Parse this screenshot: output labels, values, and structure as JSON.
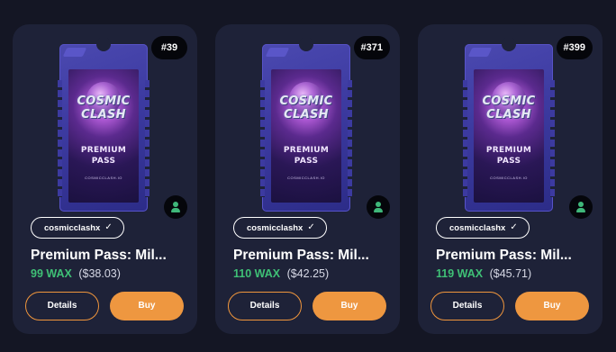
{
  "theme": {
    "page_bg": "#141624",
    "card_bg": "#1e2238",
    "accent_orange": "#ee9740",
    "wax_green": "#3fc076"
  },
  "icons": {
    "verified": "check-icon",
    "owner": "user-icon"
  },
  "ticket_art": {
    "logo_line1": "COSMIC",
    "logo_line2": "CLASH",
    "pass_line1": "PREMIUM",
    "pass_line2": "PASS",
    "footer": "COSMICCLASH.IO"
  },
  "cards": [
    {
      "asset_number": "#39",
      "collection": "cosmicclashx",
      "name": "Premium Pass: Mil...",
      "price_wax": "99 WAX",
      "price_usd": "($38.03)",
      "details_label": "Details",
      "buy_label": "Buy"
    },
    {
      "asset_number": "#371",
      "collection": "cosmicclashx",
      "name": "Premium Pass: Mil...",
      "price_wax": "110 WAX",
      "price_usd": "($42.25)",
      "details_label": "Details",
      "buy_label": "Buy"
    },
    {
      "asset_number": "#399",
      "collection": "cosmicclashx",
      "name": "Premium Pass: Mil...",
      "price_wax": "119 WAX",
      "price_usd": "($45.71)",
      "details_label": "Details",
      "buy_label": "Buy"
    }
  ]
}
